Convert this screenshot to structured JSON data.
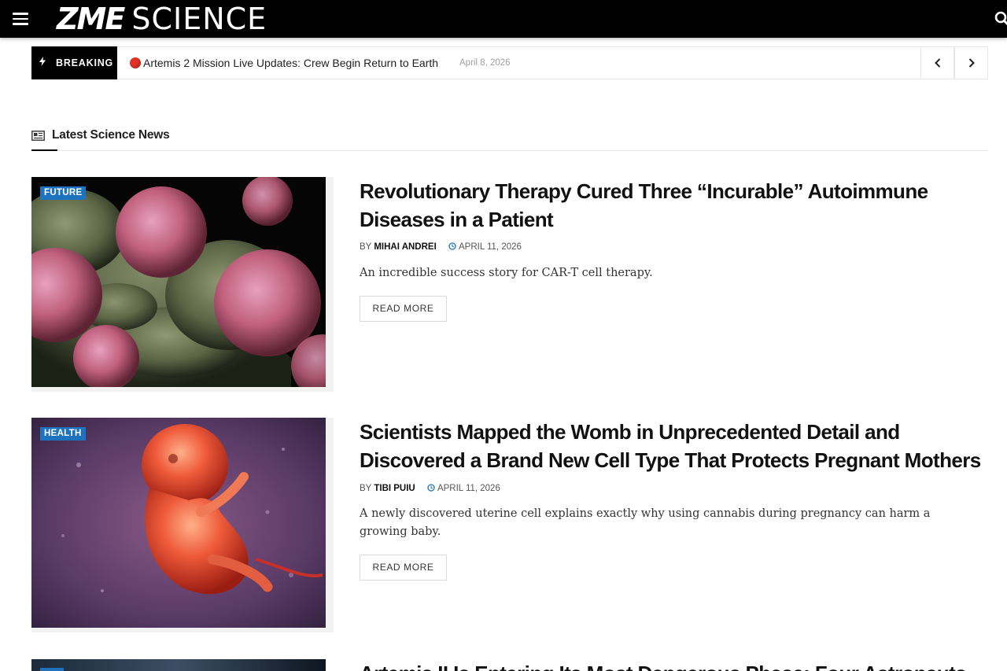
{
  "header": {
    "logo_bold": "ZME",
    "logo_light": "SCIENCE",
    "menu_icon": "hamburger-menu-icon",
    "search_icon": "search-icon"
  },
  "breaking": {
    "label": "BREAKING",
    "label_icon": "bolt-icon",
    "headline": "Artemis 2 Mission Live Updates: Crew Begin Return to Earth",
    "date": "April 8, 2026",
    "prev_icon": "chevron-left-icon",
    "next_icon": "chevron-right-icon"
  },
  "section": {
    "title": "Latest Science News",
    "icon": "newspaper-icon"
  },
  "articles": [
    {
      "category": "FUTURE",
      "title": "Revolutionary Therapy Cured Three “Incurable” Autoimmune Diseases in a Patient",
      "by": "BY",
      "author": "MIHAI ANDREI",
      "date": "APRIL 11, 2026",
      "excerpt": "An incredible success story for CAR-T cell therapy.",
      "read_more": "READ MORE"
    },
    {
      "category": "HEALTH",
      "title": "Scientists Mapped the Womb in Unprecedented Detail and Discovered a Brand New Cell Type That Protects Pregnant Mothers",
      "by": "BY",
      "author": "TIBI PUIU",
      "date": "APRIL 11, 2026",
      "excerpt": "A newly discovered uterine cell explains exactly why using cannabis during pregnancy can harm a growing baby.",
      "read_more": "READ MORE"
    },
    {
      "category": "",
      "title": "Artemis II Is Entering Its Most Dangerous Phase: Four Astronauts"
    }
  ],
  "colors": {
    "topbar": "#000000",
    "category_badge": "#1e73be",
    "live_dot": "#e23228",
    "divider": "#e6e6e6"
  }
}
